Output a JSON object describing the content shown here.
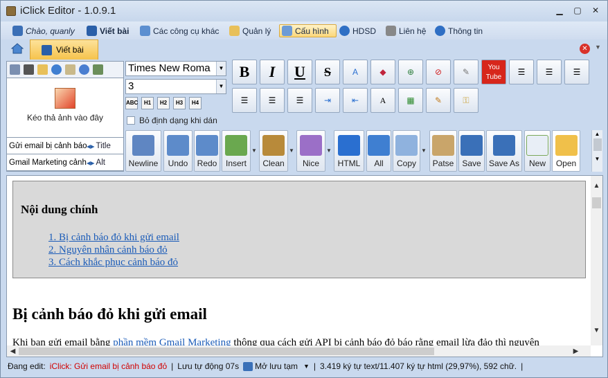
{
  "window": {
    "title": "iClick Editor - 1.0.9.1",
    "controls": [
      "minimize",
      "maximize",
      "close"
    ]
  },
  "menu": [
    {
      "label": "Chào, quanly",
      "icon": "users-icon",
      "italic": true
    },
    {
      "label": "Viết bài",
      "icon": "pencil-icon",
      "bold": true
    },
    {
      "label": "Các công cụ khác",
      "icon": "windows-icon"
    },
    {
      "label": "Quản lý",
      "icon": "folder-icon"
    },
    {
      "label": "Cấu hình",
      "icon": "config-icon",
      "active": true
    },
    {
      "label": "HDSD",
      "icon": "help-icon"
    },
    {
      "label": "Liên hệ",
      "icon": "phone-icon"
    },
    {
      "label": "Thông tin",
      "icon": "info-icon"
    }
  ],
  "tabs": [
    {
      "label": "Viết bài",
      "icon": "pencil-icon"
    }
  ],
  "image_panel": {
    "drop_label": "Kéo thả ảnh vào đây",
    "title_row": {
      "text": "Gửi email bị cảnh báo",
      "button": "Title"
    },
    "alt_row": {
      "text": "Gmail Marketing cảnh",
      "button": "Alt"
    }
  },
  "font": {
    "name": "Times New Roma",
    "size": "3"
  },
  "heading_buttons": [
    "ABC",
    "H1",
    "H2",
    "H3",
    "H4"
  ],
  "paste_plain_checkbox": {
    "label": "Bỏ định dạng khi dán",
    "checked": false
  },
  "format_buttons": [
    "B",
    "I",
    "U",
    "S"
  ],
  "toolbar": [
    {
      "label": "Newline",
      "icon": "newline-icon"
    },
    {
      "label": "Undo",
      "icon": "undo-icon"
    },
    {
      "label": "Redo",
      "icon": "redo-icon"
    },
    {
      "label": "Insert",
      "icon": "insert-icon"
    },
    {
      "label": "Clean",
      "icon": "broom-icon"
    },
    {
      "label": "Nice",
      "icon": "magic-wand-icon"
    },
    {
      "label": "HTML",
      "icon": "html-icon"
    },
    {
      "label": "All",
      "icon": "grid-icon"
    },
    {
      "label": "Copy",
      "icon": "copy-icon"
    },
    {
      "label": "Patse",
      "icon": "paste-icon"
    },
    {
      "label": "Save",
      "icon": "save-icon"
    },
    {
      "label": "Save As",
      "icon": "save-as-icon"
    },
    {
      "label": "New",
      "icon": "new-icon"
    },
    {
      "label": "Open",
      "icon": "open-folder-icon"
    }
  ],
  "editor": {
    "toc_heading": "Nội dung chính",
    "toc_items": [
      "1. Bị cảnh báo đỏ khi gửi email",
      "2. Nguyên nhân cảnh báo đỏ",
      "3. Cách khắc phục cảnh báo đỏ"
    ],
    "heading": "Bị cảnh báo đỏ khi gửi email",
    "para_before": "Khi bạn gửi email bằng ",
    "para_link": "phần mềm Gmail Marketing",
    "para_after": " thông qua cách gửi API bị cảnh báo đỏ báo rằng email lừa đảo thì nguyên"
  },
  "status": {
    "editing_label": "Đang edit:",
    "editing_value": "iClick: Gửi email bị cảnh báo đỏ",
    "autosave": "Lưu tự động 07s",
    "save_mode": "Mở lưu tạm",
    "stats": "3.419 ký tự text/11.407 ký tự html (29,97%), 592 chữ."
  },
  "colors": {
    "ribbon": "#c9d9ee",
    "tab_active": "#f6c34c",
    "link": "#1a5bb8",
    "status_red": "#d10000"
  }
}
